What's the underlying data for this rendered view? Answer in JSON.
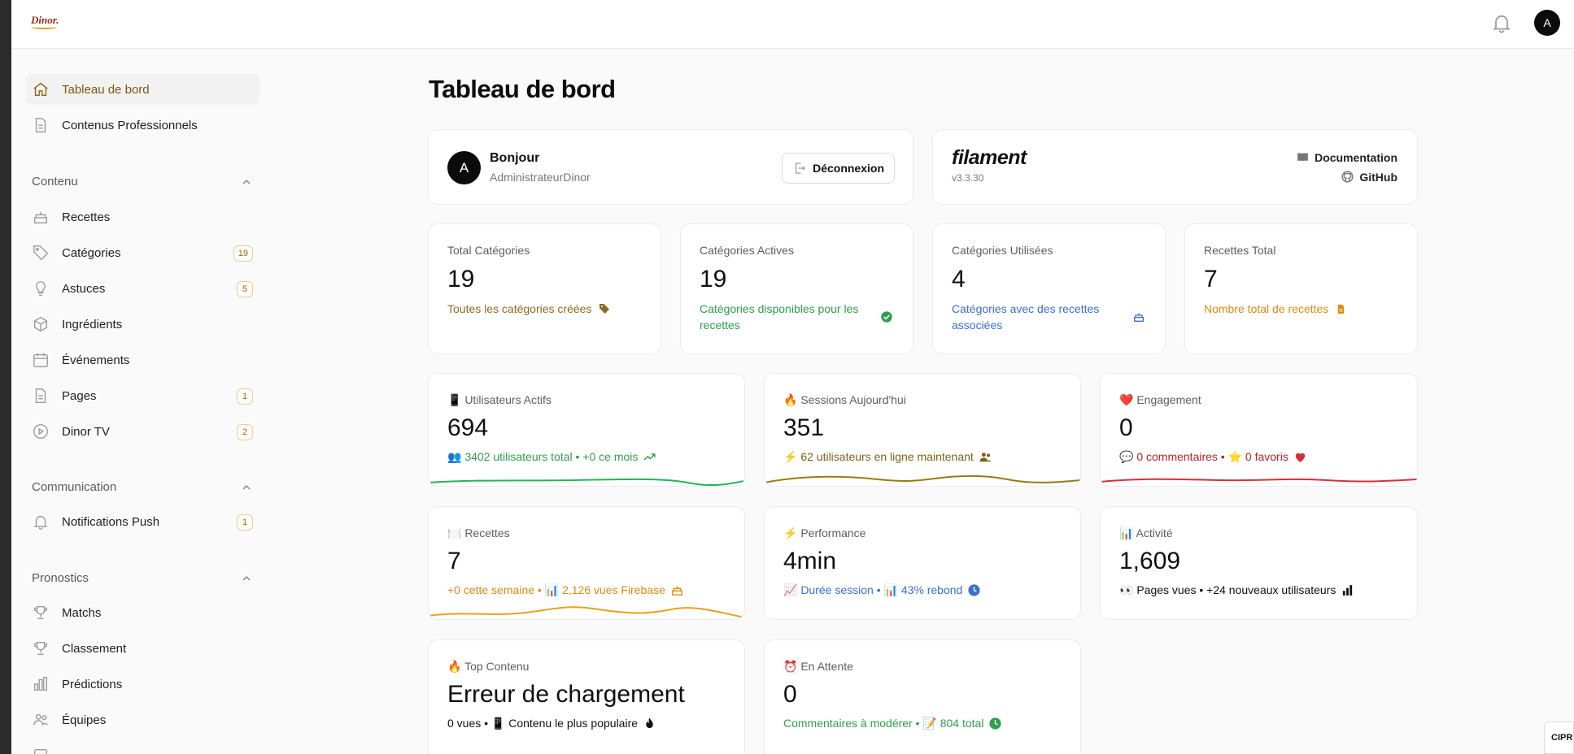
{
  "brand": {
    "logo_text": "Dinor."
  },
  "topbar": {
    "user_initial": "A"
  },
  "sidebar": {
    "top_items": [
      {
        "label": "Tableau de bord",
        "icon": "home-icon",
        "active": true
      },
      {
        "label": "Contenus Professionnels",
        "icon": "document-icon"
      }
    ],
    "groups": [
      {
        "label": "Contenu",
        "items": [
          {
            "label": "Recettes",
            "icon": "cake-icon",
            "badge": ""
          },
          {
            "label": "Catégories",
            "icon": "tag-icon",
            "badge": "19"
          },
          {
            "label": "Astuces",
            "icon": "lightbulb-icon",
            "badge": "5"
          },
          {
            "label": "Ingrédients",
            "icon": "cube-icon",
            "badge": ""
          },
          {
            "label": "Événements",
            "icon": "calendar-icon",
            "badge": ""
          },
          {
            "label": "Pages",
            "icon": "document-icon",
            "badge": "1"
          },
          {
            "label": "Dinor TV",
            "icon": "play-icon",
            "badge": "2"
          }
        ]
      },
      {
        "label": "Communication",
        "items": [
          {
            "label": "Notifications Push",
            "icon": "bell-icon",
            "badge": "1"
          }
        ]
      },
      {
        "label": "Pronostics",
        "items": [
          {
            "label": "Matchs",
            "icon": "trophy-icon",
            "badge": ""
          },
          {
            "label": "Classement",
            "icon": "trophy-icon",
            "badge": ""
          },
          {
            "label": "Prédictions",
            "icon": "bar-chart-icon",
            "badge": ""
          },
          {
            "label": "Équipes",
            "icon": "users-icon",
            "badge": ""
          }
        ]
      }
    ]
  },
  "main": {
    "title": "Tableau de bord",
    "welcome": {
      "initial": "A",
      "greeting": "Bonjour",
      "name": "AdministrateurDinor",
      "logout_label": "Déconnexion"
    },
    "filament": {
      "logo": "filament",
      "version": "v3.3.30",
      "doc_label": "Documentation",
      "github_label": "GitHub"
    },
    "stats": [
      {
        "label": "Total Catégories",
        "value": "19",
        "desc": "Toutes les catégories créées",
        "color": "#8a6d1f",
        "icon": "tag-icon"
      },
      {
        "label": "Catégories Actives",
        "value": "19",
        "desc": "Catégories disponibles pour les recettes",
        "color": "#2f9e4f",
        "icon": "check-circle-icon"
      },
      {
        "label": "Catégories Utilisées",
        "value": "4",
        "desc": "Catégories avec des recettes associées",
        "color": "#3b6fd1",
        "icon": "cake-icon"
      },
      {
        "label": "Recettes Total",
        "value": "7",
        "desc": "Nombre total de recettes",
        "color": "#dd8b14",
        "icon": "document-icon"
      }
    ],
    "widgets": [
      {
        "label": "📱 Utilisateurs Actifs",
        "value": "694",
        "desc": "👥 3402 utilisateurs total • +0 ce mois",
        "color": "#2f9e4f",
        "icon": "trending-up-icon",
        "spark": "#22b45a"
      },
      {
        "label": "🔥 Sessions Aujourd'hui",
        "value": "351",
        "desc": "⚡ 62 utilisateurs en ligne maintenant",
        "color": "#7a6316",
        "icon": "users-icon",
        "spark": "#9a7a14"
      },
      {
        "label": "❤️ Engagement",
        "value": "0",
        "desc": "💬 0 commentaires • ⭐ 0 favoris",
        "color": "#b4232a",
        "icon": "heart-icon",
        "spark": "#d6303a"
      },
      {
        "label": "🍽️ Recettes",
        "value": "7",
        "desc": "+0 cette semaine • 📊 2,126 vues Firebase",
        "color": "#dd8b14",
        "icon": "cake-icon",
        "spark": "#e9a21a"
      },
      {
        "label": "⚡ Performance",
        "value": "4min",
        "desc": "📈 Durée session • 📊 43% rebond",
        "color": "#3b6fd1",
        "icon": "clock-icon",
        "spark": ""
      },
      {
        "label": "📊 Activité",
        "value": "1,609",
        "desc": "👀 Pages vues • +24 nouveaux utilisateurs",
        "color": "#111111",
        "icon": "bar-chart-icon",
        "spark": ""
      },
      {
        "label": "🔥 Top Contenu",
        "value": "Erreur de chargement",
        "desc": "0 vues • 📱 Contenu le plus populaire",
        "color": "#111111",
        "icon": "fire-icon",
        "spark": ""
      },
      {
        "label": "⏰ En Attente",
        "value": "0",
        "desc": "Commentaires à modérer • 📝 804 total",
        "color": "#2f9e4f",
        "icon": "clock-icon",
        "spark": ""
      }
    ]
  },
  "corner_tag": "CIPR"
}
